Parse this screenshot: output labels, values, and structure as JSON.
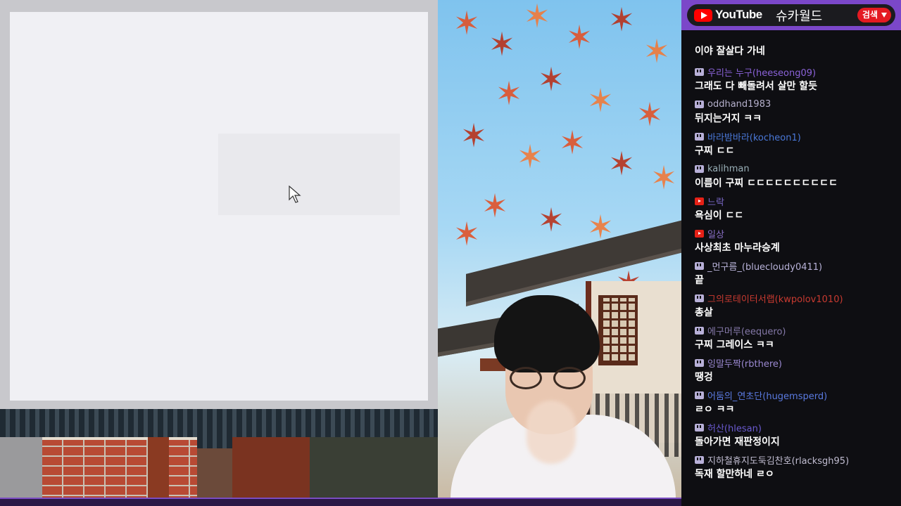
{
  "header": {
    "platform_label": "YouTube",
    "channel_name": "슈카월드",
    "search_label": "검색"
  },
  "chat": {
    "messages": [
      {
        "platform": "twitch",
        "user": "",
        "text": "이야 잘살다 가네",
        "user_color": "#8a80b8"
      },
      {
        "platform": "twitch",
        "user": "우리는 누구(heeseong09)",
        "text": "그래도 다 빼돌려서 살만 할듯",
        "user_color": "#8a62d8"
      },
      {
        "platform": "twitch",
        "user": "oddhand1983",
        "text": "뒤지는거지 ㅋㅋ",
        "user_color": "#b5b0cc"
      },
      {
        "platform": "twitch",
        "user": "바라밤바라(kocheon1)",
        "text": "구찌 ㄷㄷ",
        "user_color": "#4a78d8"
      },
      {
        "platform": "twitch",
        "user": "kalihman",
        "text": "이름이 구찌 ㄷㄷㄷㄷㄷㄷㄷㄷㄷㄷ",
        "user_color": "#9ab0b8"
      },
      {
        "platform": "youtube",
        "user": "느락",
        "text": "욕심이 ㄷㄷ",
        "user_color": "#7a68c8"
      },
      {
        "platform": "youtube",
        "user": "일상",
        "text": "사상최초 마누라승계",
        "user_color": "#8a70c8"
      },
      {
        "platform": "twitch",
        "user": "_먼구름_(bluecloudy0411)",
        "text": "끝",
        "user_color": "#b8b2d8"
      },
      {
        "platform": "twitch",
        "user": "그의로테이터서랩(kwpolov1010)",
        "text": "총살",
        "user_color": "#c83a30"
      },
      {
        "platform": "twitch",
        "user": "에구머루(eequero)",
        "text": "구찌 그레이스 ㅋㅋ",
        "user_color": "#8478a8"
      },
      {
        "platform": "twitch",
        "user": "잉말두짝(rbthere)",
        "text": "땡겅",
        "user_color": "#9a88d0"
      },
      {
        "platform": "twitch",
        "user": "어둠의_연초단(hugemsperd)",
        "text": "ㄹㅇ ㅋㅋ",
        "user_color": "#5a7ae0"
      },
      {
        "platform": "twitch",
        "user": "허산(hlesan)",
        "text": "돌아가면 재판정이지",
        "user_color": "#6a5ad0"
      },
      {
        "platform": "twitch",
        "user": "지하철휴지도둑김찬호(rlacksgh95)",
        "text": "독재 할만하네 ㄹㅇ",
        "user_color": "#c0bcd0"
      }
    ]
  }
}
